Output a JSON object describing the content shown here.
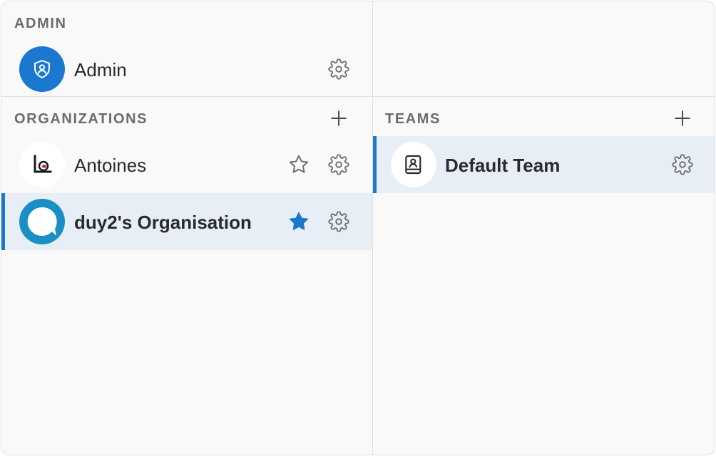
{
  "admin": {
    "section_title": "ADMIN",
    "item": {
      "label": "Admin",
      "icon": "shield-user-icon"
    }
  },
  "organizations": {
    "section_title": "ORGANIZATIONS",
    "add_icon": "plus-icon",
    "items": [
      {
        "label": "Antoines",
        "favorite": false,
        "selected": false
      },
      {
        "label": "duy2's Organisation",
        "favorite": true,
        "selected": true
      }
    ]
  },
  "teams": {
    "section_title": "TEAMS",
    "add_icon": "plus-icon",
    "items": [
      {
        "label": "Default Team",
        "selected": true,
        "icon": "contact-book-icon"
      }
    ]
  },
  "colors": {
    "accent": "#1a78cf",
    "selected_bg": "#e8eef5",
    "panel_bg": "#f9f9f9",
    "section_title": "#6b6b70",
    "icon_gray": "#6e6e73",
    "star_filled": "#1a78cf",
    "org_avatar_ring": "#1b8fc4"
  }
}
